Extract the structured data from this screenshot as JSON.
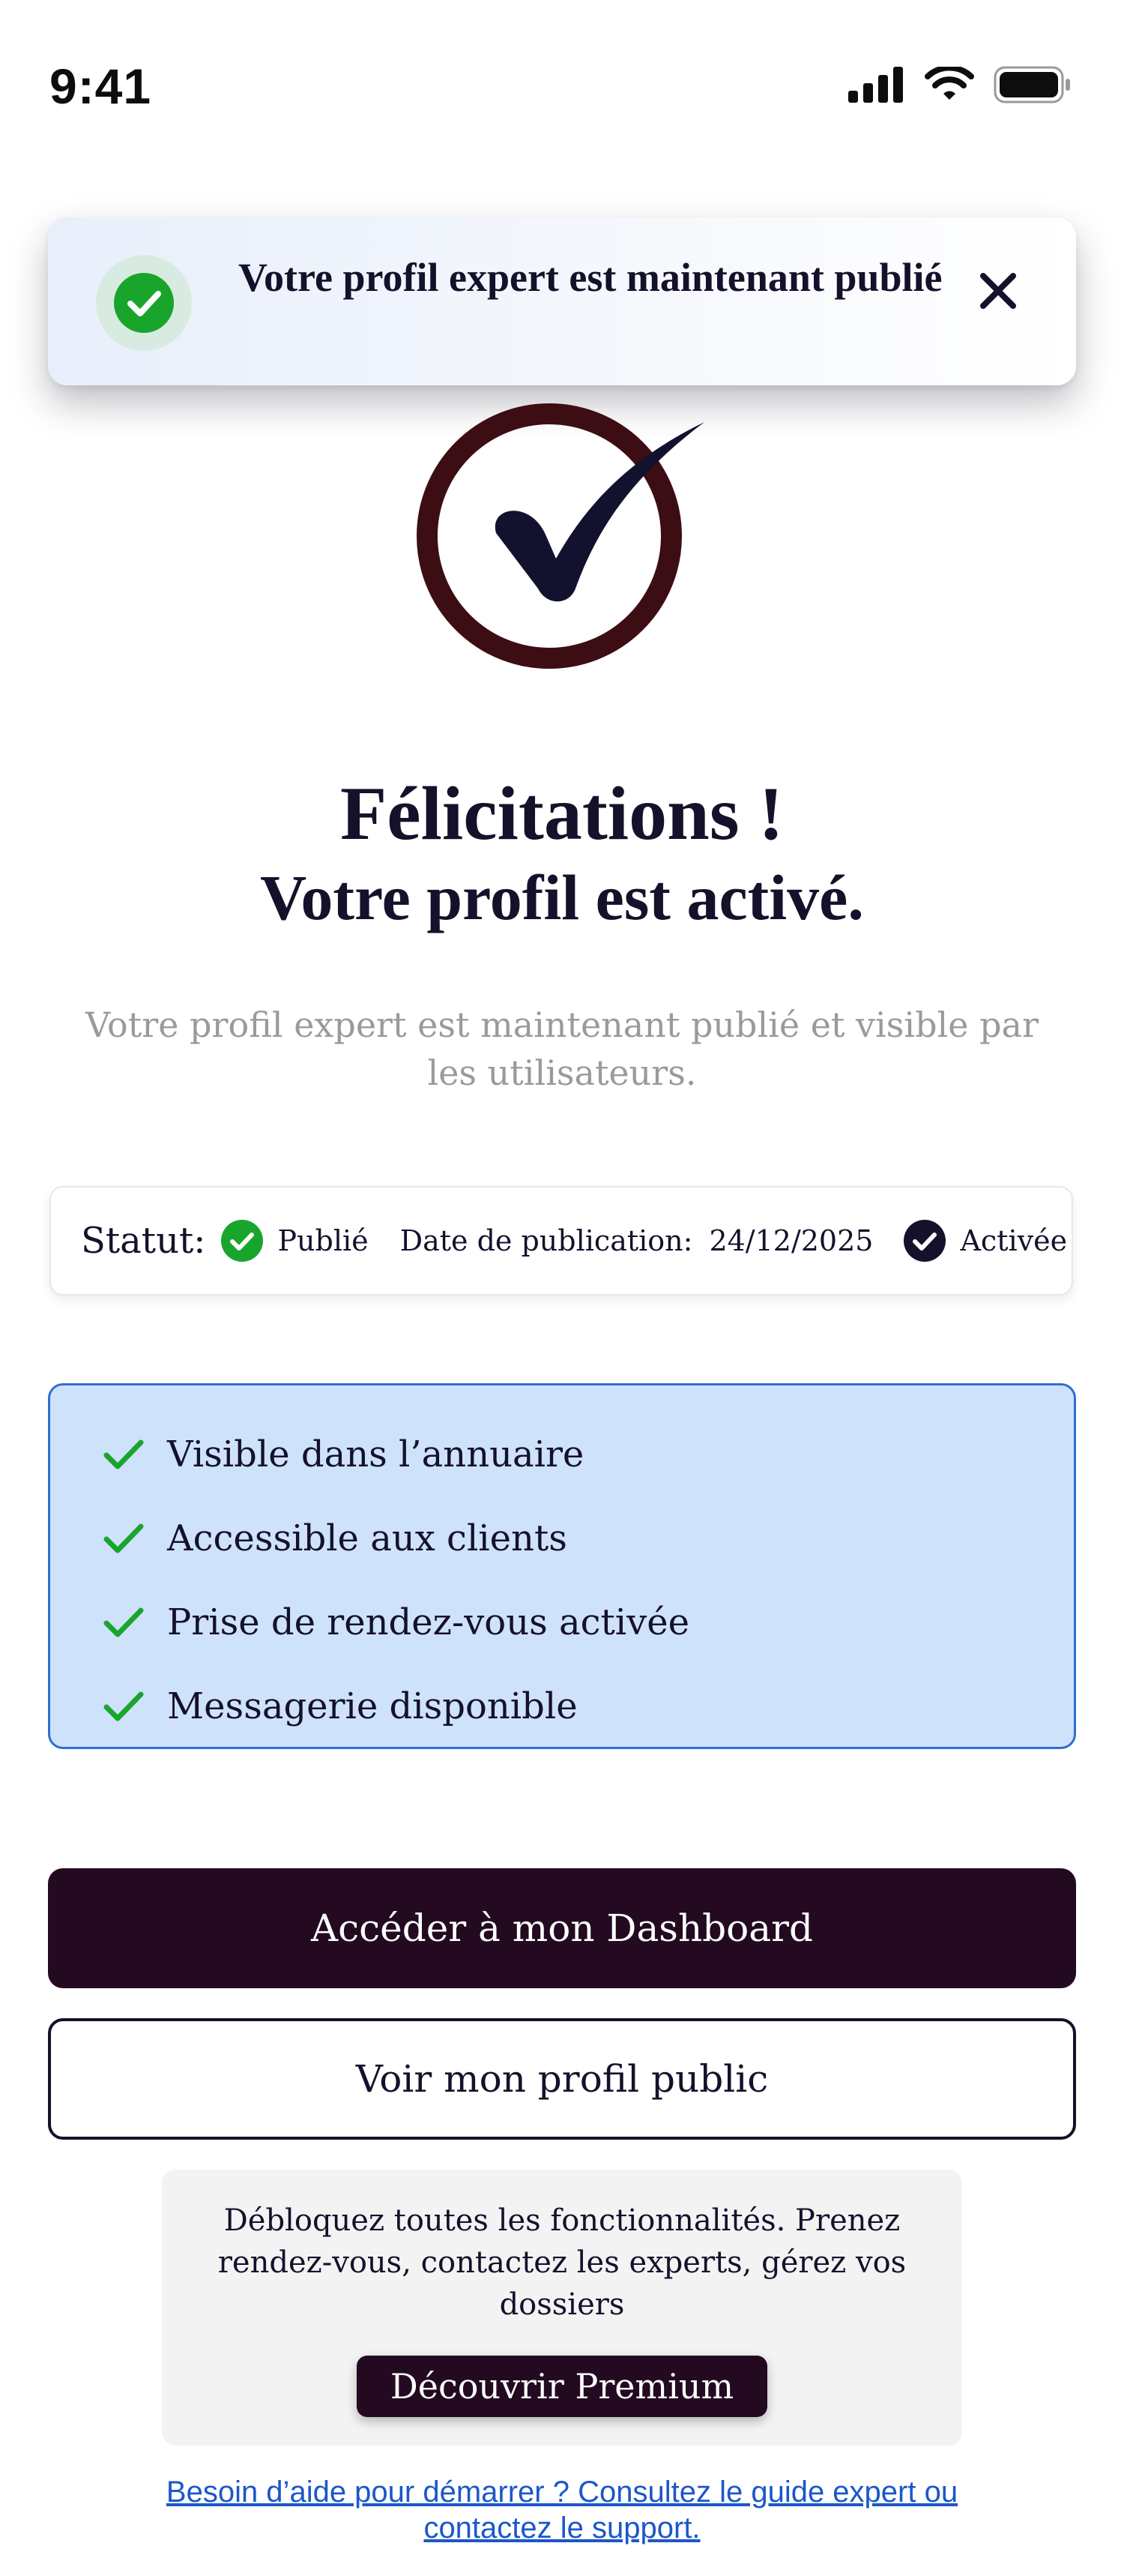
{
  "status_bar": {
    "time": "9:41",
    "icons": [
      "signal-icon",
      "wifi-icon",
      "battery-icon"
    ]
  },
  "toast": {
    "message": "Votre profil expert est maintenant publié",
    "icon": "check-circle-icon",
    "close_icon": "close-icon"
  },
  "hero": {
    "icon": "large-check-circle-icon",
    "title": "Félicitations !",
    "subtitle": "Votre profil est activé.",
    "description": "Votre profil expert est maintenant publié et visible par les utilisateurs."
  },
  "status_card": {
    "status_label": "Statut:",
    "status_value": "Publié",
    "date_label": "Date de publication:",
    "date_value": "24/12/2025",
    "activation_value": "Activée"
  },
  "features": {
    "items": [
      "Visible dans l’annuaire",
      "Accessible aux clients",
      "Prise de rendez-vous activée",
      "Messagerie disponible"
    ]
  },
  "actions": {
    "primary_label": "Accéder à mon Dashboard",
    "secondary_label": "Voir mon profil public"
  },
  "premium": {
    "text": "Débloquez toutes les fonctionnalités. Prenez rendez-vous, contactez les experts, gérez vos dossiers",
    "button_label": "Découvrir Premium"
  },
  "help": {
    "link_text": "Besoin d’aide pour démarrer ? Consultez le guide expert ou contactez le support."
  },
  "colors": {
    "primary": "#230a20",
    "navy": "#14112b",
    "success": "#19a52c",
    "feature_bg": "#cfe2fb",
    "feature_border": "#2e6fd0",
    "link": "#1b57c9",
    "hero_ring": "#3d0d14"
  }
}
